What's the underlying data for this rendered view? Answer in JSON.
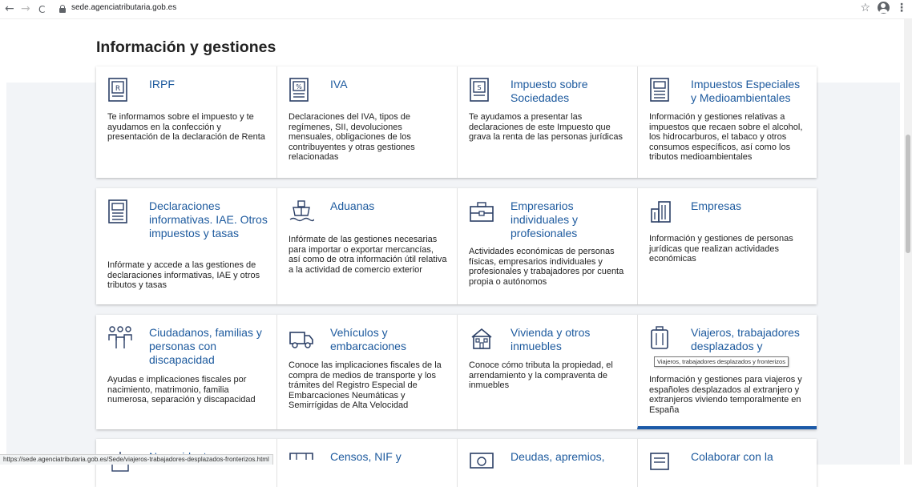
{
  "browser": {
    "back": "←",
    "forward": "→",
    "reload": "C",
    "url": "sede.agenciatributaria.gob.es",
    "star": "☆",
    "menu": "⋮"
  },
  "page": {
    "title": "Información y gestiones"
  },
  "cards": {
    "irpf": {
      "title": "IRPF",
      "desc": "Te informamos sobre el impuesto y te ayudamos en la confección y presentación de la declaración de Renta"
    },
    "iva": {
      "title": "IVA",
      "desc": "Declaraciones del IVA, tipos de regímenes, SII, devoluciones mensuales, obligaciones de los contribuyentes y otras gestiones relacionadas"
    },
    "sociedades": {
      "title": "Impuesto sobre Sociedades",
      "desc": "Te ayudamos a presentar las declaraciones de este Impuesto que grava la renta de las personas jurídicas"
    },
    "especiales": {
      "title": "Impuestos Especiales y Medioambientales",
      "desc": "Información y gestiones relativas a impuestos que recaen sobre el alcohol, los hidrocarburos, el tabaco y otros consumos específicos, así como los tributos medioambientales"
    },
    "informativas": {
      "title": "Declaraciones informativas. IAE. Otros impuestos y tasas",
      "desc": "Infórmate y accede a las gestiones de declaraciones informativas, IAE y otros tributos y tasas"
    },
    "aduanas": {
      "title": "Aduanas",
      "desc": "Infórmate de las gestiones necesarias para importar o exportar mercancías, así como de otra información útil relativa a la actividad de comercio exterior"
    },
    "empresarios": {
      "title": "Empresarios individuales y profesionales",
      "desc": "Actividades económicas de personas físicas, empresarios individuales y profesionales y trabajadores por cuenta propia o autónomos"
    },
    "empresas": {
      "title": "Empresas",
      "desc": "Información y gestiones de personas jurídicas que realizan actividades económicas"
    },
    "ciudadanos": {
      "title": "Ciudadanos, familias y personas con discapacidad",
      "desc": "Ayudas e implicaciones fiscales por nacimiento, matrimonio, familia numerosa, separación y discapacidad"
    },
    "vehiculos": {
      "title": "Vehículos y embarcaciones",
      "desc": "Conoce las implicaciones fiscales de la compra de medios de transporte y los trámites del Registro Especial de Embarcaciones Neumáticas y Semirrígidas de Alta Velocidad"
    },
    "vivienda": {
      "title": "Vivienda y otros inmuebles",
      "desc": "Conoce cómo tributa la propiedad, el arrendamiento y la compraventa de inmuebles"
    },
    "viajeros": {
      "title": "Viajeros, trabajadores desplazados y",
      "desc": "Información y gestiones para viajeros y españoles desplazados al extranjero y extranjeros viviendo temporalmente en España"
    },
    "no_residentes": {
      "title": "No residentes"
    },
    "censos": {
      "title": "Censos, NIF y"
    },
    "deudas": {
      "title": "Deudas, apremios,"
    },
    "colaborar": {
      "title": "Colaborar con la"
    }
  },
  "tooltip": "Viajeros, trabajadores desplazados y fronterizos",
  "status_url": "https://sede.agenciatributaria.gob.es/Sede/viajeros-trabajadores-desplazados-fronterizos.html",
  "colors": {
    "link": "#1d5a9e",
    "accent_bar": "#1c5aa8",
    "background_band": "#f2f4f7"
  }
}
